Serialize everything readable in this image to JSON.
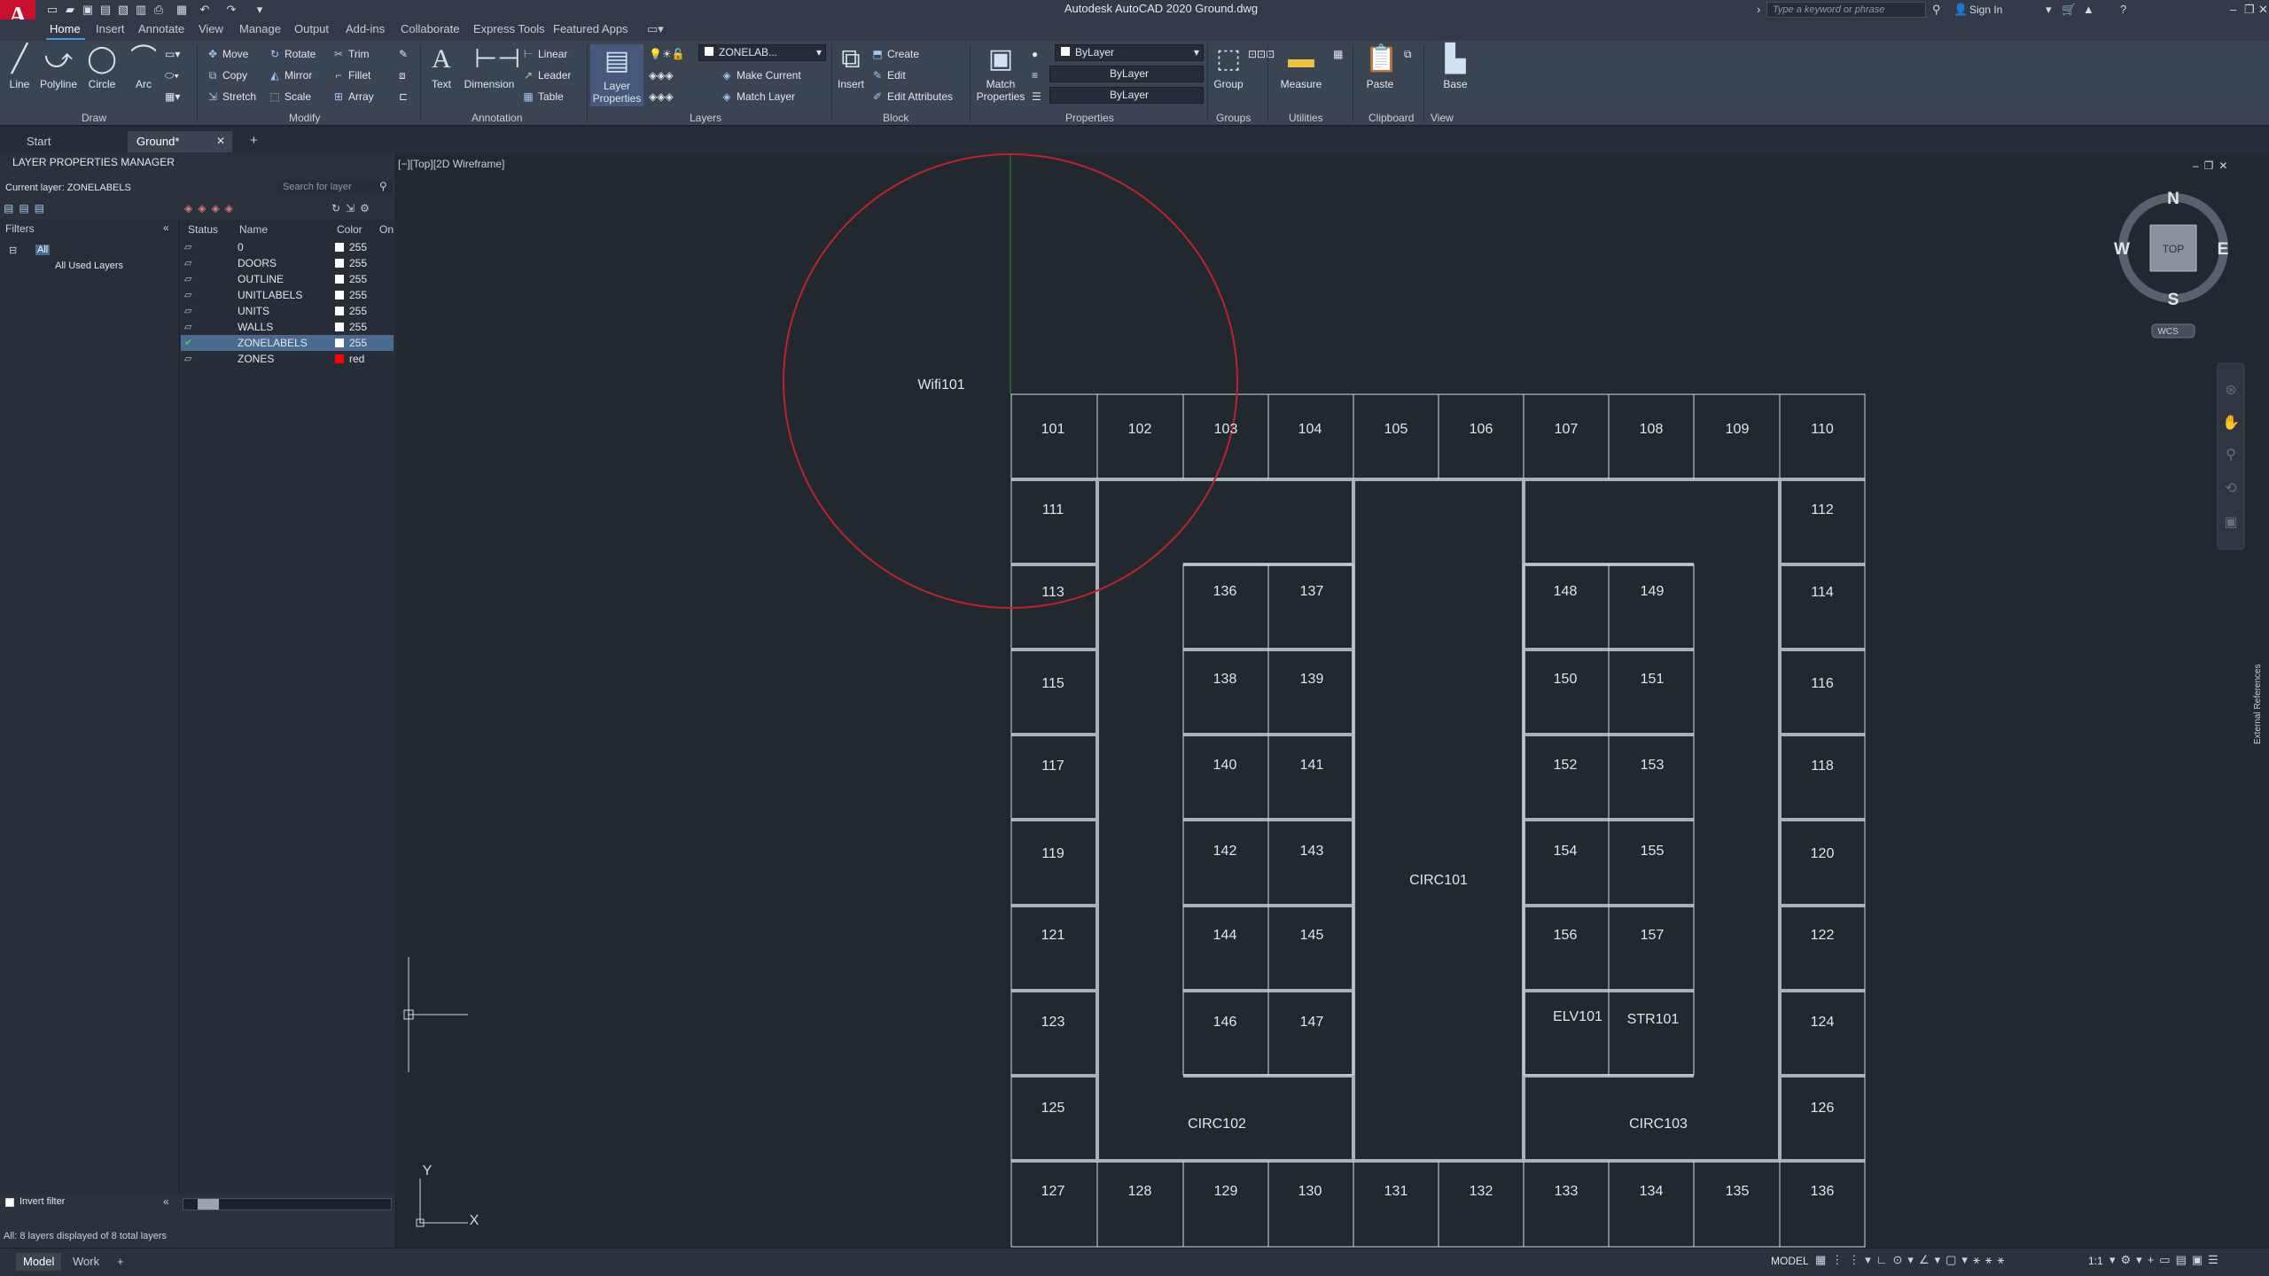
{
  "app": {
    "logo": "A",
    "title": "Autodesk AutoCAD 2020   Ground.dwg"
  },
  "quick_access": {
    "icons": [
      "new-icon",
      "open-icon",
      "save-icon",
      "saveas-icon",
      "cloud-open-icon",
      "cloud-save-icon",
      "plot-icon",
      "undo-icon",
      "redo-icon",
      "customize-icon"
    ]
  },
  "topright": {
    "search_placeholder": "Type a keyword or phrase",
    "signin": "Sign In"
  },
  "ribbon_tabs": [
    "Home",
    "Insert",
    "Annotate",
    "View",
    "Manage",
    "Output",
    "Add-ins",
    "Collaborate",
    "Express Tools",
    "Featured Apps"
  ],
  "ribbon": {
    "draw": {
      "line": "Line",
      "polyline": "Polyline",
      "circle": "Circle",
      "arc": "Arc",
      "title": "Draw"
    },
    "modify": {
      "move": "Move",
      "rotate": "Rotate",
      "trim": "Trim",
      "copy": "Copy",
      "mirror": "Mirror",
      "fillet": "Fillet",
      "stretch": "Stretch",
      "scale": "Scale",
      "array": "Array",
      "title": "Modify"
    },
    "annotation": {
      "text": "Text",
      "dimension": "Dimension",
      "linear": "Linear",
      "leader": "Leader",
      "table": "Table",
      "title": "Annotation"
    },
    "layers": {
      "layer_properties": "Layer Properties",
      "current": "ZONELAB...",
      "make_current": "Make Current",
      "match_layer": "Match Layer",
      "title": "Layers"
    },
    "block": {
      "insert": "Insert",
      "create": "Create",
      "edit": "Edit",
      "edit_attributes": "Edit Attributes",
      "title": "Block"
    },
    "properties": {
      "match": "Match Properties",
      "color": "ByLayer",
      "linetype": "ByLayer",
      "lineweight": "ByLayer",
      "title": "Properties"
    },
    "groups": {
      "group": "Group",
      "title": "Groups"
    },
    "utilities": {
      "measure": "Measure",
      "title": "Utilities"
    },
    "clipboard": {
      "paste": "Paste",
      "title": "Clipboard"
    },
    "view": {
      "base": "Base",
      "title": "View"
    }
  },
  "doc_tabs": {
    "start": "Start",
    "ground": "Ground*"
  },
  "layer_manager": {
    "title": "LAYER PROPERTIES MANAGER",
    "current_layer": "Current layer: ZONELABELS",
    "search_placeholder": "Search for layer",
    "filters_label": "Filters",
    "tree": {
      "all": "All",
      "all_used": "All Used Layers"
    },
    "columns": {
      "status": "Status",
      "name": "Name",
      "color": "Color",
      "on": "On"
    },
    "layers": [
      {
        "name": "0",
        "color": "255",
        "swatch": "#ffffff"
      },
      {
        "name": "DOORS",
        "color": "255",
        "swatch": "#ffffff"
      },
      {
        "name": "OUTLINE",
        "color": "255",
        "swatch": "#ffffff"
      },
      {
        "name": "UNITLABELS",
        "color": "255",
        "swatch": "#ffffff"
      },
      {
        "name": "UNITS",
        "color": "255",
        "swatch": "#ffffff"
      },
      {
        "name": "WALLS",
        "color": "255",
        "swatch": "#ffffff"
      },
      {
        "name": "ZONELABELS",
        "color": "255",
        "swatch": "#ffffff",
        "current": true
      },
      {
        "name": "ZONES",
        "color": "red",
        "swatch": "#ff0000"
      }
    ],
    "invert_filter": "Invert filter",
    "status": "All: 8 layers displayed of 8 total layers"
  },
  "viewport": {
    "label": "[−][Top][2D Wireframe]"
  },
  "viewcube": {
    "n": "N",
    "s": "S",
    "e": "E",
    "w": "W",
    "top": "TOP",
    "wcs": "WCS"
  },
  "side_panel": {
    "xrefs": "External References"
  },
  "ucs": {
    "x": "X",
    "y": "Y"
  },
  "drawing": {
    "wifi": "Wifi101",
    "circulation": [
      "CIRC101",
      "CIRC102",
      "CIRC103"
    ],
    "special": [
      "ELV101",
      "STR101"
    ],
    "rooms": [
      "101",
      "102",
      "103",
      "104",
      "105",
      "106",
      "107",
      "108",
      "109",
      "110",
      "111",
      "112",
      "113",
      "114",
      "115",
      "116",
      "117",
      "118",
      "119",
      "120",
      "121",
      "122",
      "123",
      "124",
      "125",
      "126",
      "127",
      "128",
      "129",
      "130",
      "131",
      "132",
      "133",
      "134",
      "135",
      "136",
      "136",
      "137",
      "138",
      "139",
      "140",
      "141",
      "142",
      "143",
      "144",
      "145",
      "146",
      "147",
      "148",
      "149",
      "150",
      "151",
      "152",
      "153",
      "154",
      "155",
      "156",
      "157"
    ]
  },
  "layout_tabs": {
    "model": "Model",
    "work": "Work"
  },
  "statusbar": {
    "model": "MODEL",
    "scale": "1:1"
  }
}
